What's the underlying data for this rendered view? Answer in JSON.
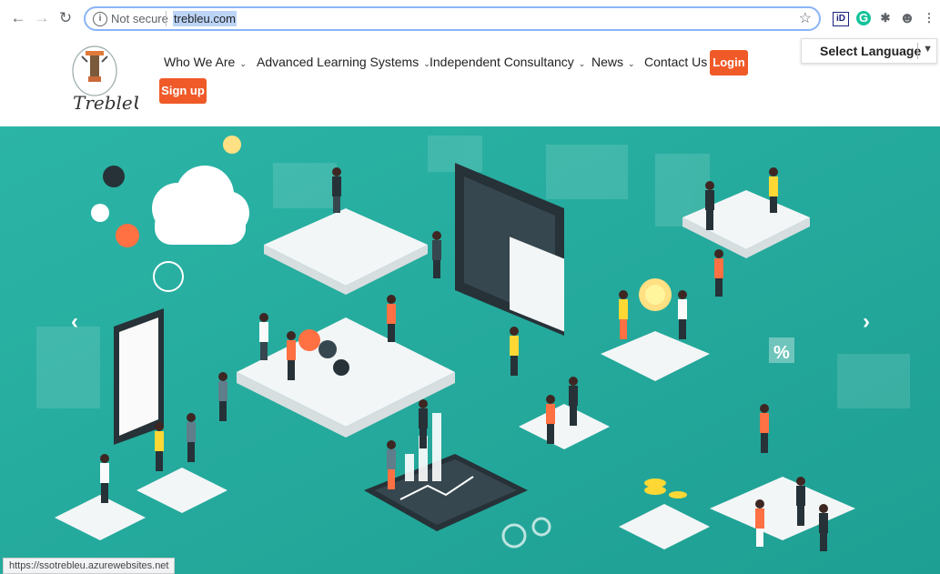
{
  "browser": {
    "security_label": "Not secure",
    "url": "trebleu.com"
  },
  "language": {
    "label": "Select Language"
  },
  "logo": {
    "text": "TrebleU"
  },
  "nav": {
    "items": [
      {
        "label": "Who We Are"
      },
      {
        "label": "Advanced Learning Systems"
      },
      {
        "label": "Independent Consultancy"
      },
      {
        "label": "News"
      },
      {
        "label": "Contact Us"
      }
    ],
    "login_label": "Login",
    "signup_label": "Sign up"
  },
  "status_bar": {
    "text": "https://ssotrebleu.azurewebsites.net"
  },
  "colors": {
    "accent": "#f05a28",
    "hero_teal": "#2fb8a8",
    "hero_dark": "#159a8c"
  }
}
